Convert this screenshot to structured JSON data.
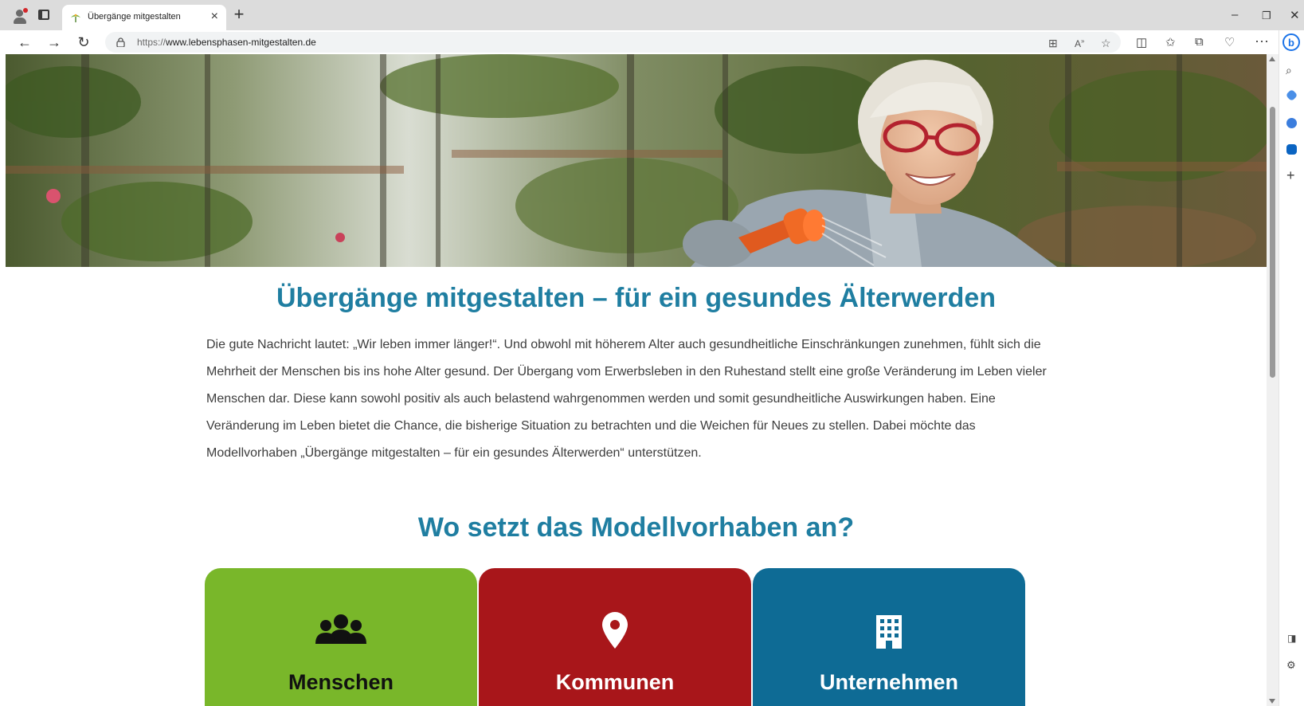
{
  "browser": {
    "tab_title": "Übergänge mitgestalten",
    "url_protocol": "https://",
    "url_host": "www.lebensphasen-mitgestalten.de"
  },
  "page": {
    "heading": "Übergänge mitgestalten – für ein gesundes Älterwerden",
    "intro": "Die gute Nachricht lautet: „Wir leben immer länger!“. Und obwohl mit höherem Alter auch gesundheitliche Einschränkungen zunehmen, fühlt sich die Mehrheit der Menschen bis ins hohe Alter gesund. Der Übergang vom Erwerbsleben in den Ruhestand stellt eine große Veränderung im Leben vieler Menschen dar. Diese kann sowohl positiv als auch belastend wahrgenommen werden und somit gesundheitliche Auswirkungen haben. Eine Veränderung im Leben bietet die Chance, die bisherige Situation zu betrachten und die Weichen für Neues zu stellen. Dabei möchte das Modellvorhaben „Übergänge mitgestalten – für ein gesundes Älterwerden“ unterstützen.",
    "subheading": "Wo setzt das Modellvorhaben an?",
    "cards": [
      {
        "label": "Menschen",
        "icon": "users-icon",
        "color": "#79b72a",
        "text_color": "#111111"
      },
      {
        "label": "Kommunen",
        "icon": "map-pin-icon",
        "color": "#a8161a",
        "text_color": "#ffffff"
      },
      {
        "label": "Unternehmen",
        "icon": "building-icon",
        "color": "#0e6b95",
        "text_color": "#ffffff"
      }
    ]
  },
  "colors": {
    "heading": "#1f7ea1",
    "body_text": "#3d3d3d"
  }
}
